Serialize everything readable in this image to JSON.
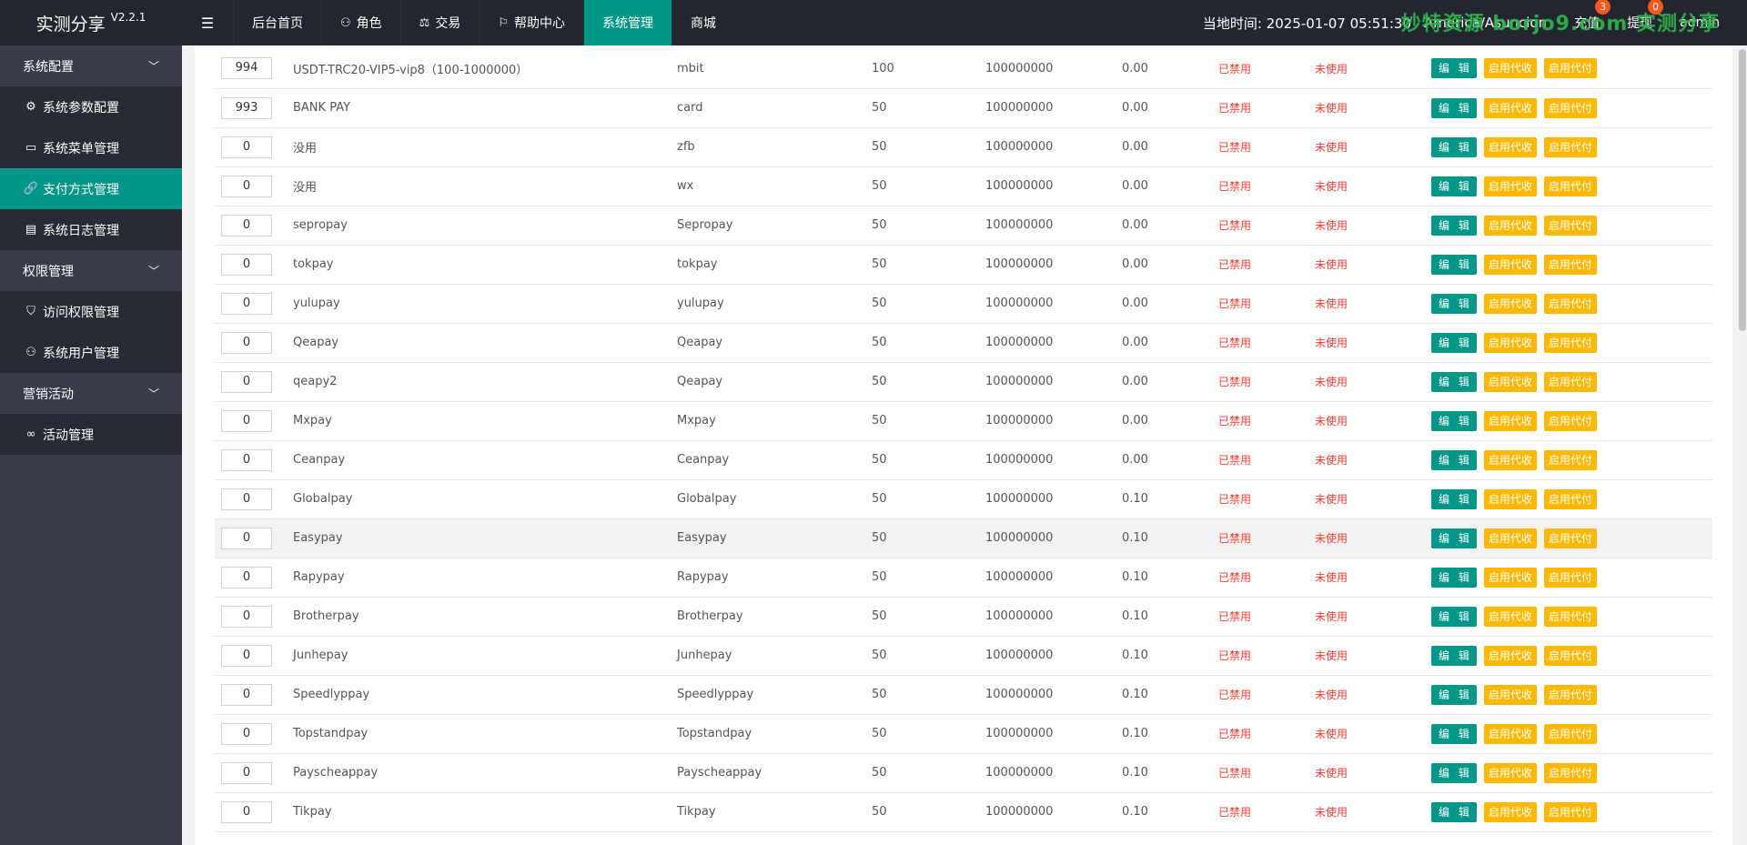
{
  "app": {
    "name": "实测分享",
    "version": "V2.2.1"
  },
  "topnav": [
    {
      "label": "后台首页",
      "icon": ""
    },
    {
      "label": "角色",
      "icon": "user-icon"
    },
    {
      "label": "交易",
      "icon": "scale-icon"
    },
    {
      "label": "帮助中心",
      "icon": "flag-icon"
    },
    {
      "label": "系统管理",
      "icon": ""
    },
    {
      "label": "商城",
      "icon": ""
    }
  ],
  "header": {
    "time_label": "当地时间: 2025-01-07 05:51:30",
    "timezone": "America/Asuncion",
    "recharge": {
      "label": "充值",
      "badge": "3"
    },
    "withdraw": {
      "label": "提现",
      "badge": "0"
    },
    "user": "admin",
    "watermark": "妙特资源 borjo9.com 实测分享"
  },
  "sidebar": {
    "groups": [
      {
        "label": "系统配置",
        "items": [
          {
            "label": "系统参数配置",
            "icon": "gear-icon"
          },
          {
            "label": "系统菜单管理",
            "icon": "window-icon"
          },
          {
            "label": "支付方式管理",
            "icon": "link-icon",
            "active": true
          },
          {
            "label": "系统日志管理",
            "icon": "doc-icon"
          }
        ]
      },
      {
        "label": "权限管理",
        "items": [
          {
            "label": "访问权限管理",
            "icon": "shield-icon"
          },
          {
            "label": "系统用户管理",
            "icon": "user-icon"
          }
        ]
      },
      {
        "label": "营销活动",
        "items": [
          {
            "label": "活动管理",
            "icon": "infinity-icon"
          }
        ]
      }
    ]
  },
  "table": {
    "actions": {
      "edit": "编 辑",
      "collect": "启用代收",
      "pay": "启用代付"
    },
    "rows": [
      {
        "sort": "994",
        "name": "USDT-TRC20-VIP5-vip8（100-1000000）",
        "code": "mbit",
        "rate": "100",
        "max": "100000000",
        "fee": "0.00",
        "status": "已禁用",
        "used": "未使用"
      },
      {
        "sort": "993",
        "name": "BANK PAY",
        "code": "card",
        "rate": "50",
        "max": "100000000",
        "fee": "0.00",
        "status": "已禁用",
        "used": "未使用"
      },
      {
        "sort": "0",
        "name": "没用",
        "code": "zfb",
        "rate": "50",
        "max": "100000000",
        "fee": "0.00",
        "status": "已禁用",
        "used": "未使用"
      },
      {
        "sort": "0",
        "name": "没用",
        "code": "wx",
        "rate": "50",
        "max": "100000000",
        "fee": "0.00",
        "status": "已禁用",
        "used": "未使用"
      },
      {
        "sort": "0",
        "name": "sepropay",
        "code": "Sepropay",
        "rate": "50",
        "max": "100000000",
        "fee": "0.00",
        "status": "已禁用",
        "used": "未使用"
      },
      {
        "sort": "0",
        "name": "tokpay",
        "code": "tokpay",
        "rate": "50",
        "max": "100000000",
        "fee": "0.00",
        "status": "已禁用",
        "used": "未使用"
      },
      {
        "sort": "0",
        "name": "yulupay",
        "code": "yulupay",
        "rate": "50",
        "max": "100000000",
        "fee": "0.00",
        "status": "已禁用",
        "used": "未使用"
      },
      {
        "sort": "0",
        "name": "Qeapay",
        "code": "Qeapay",
        "rate": "50",
        "max": "100000000",
        "fee": "0.00",
        "status": "已禁用",
        "used": "未使用"
      },
      {
        "sort": "0",
        "name": "qeapy2",
        "code": "Qeapay",
        "rate": "50",
        "max": "100000000",
        "fee": "0.00",
        "status": "已禁用",
        "used": "未使用"
      },
      {
        "sort": "0",
        "name": "Mxpay",
        "code": "Mxpay",
        "rate": "50",
        "max": "100000000",
        "fee": "0.00",
        "status": "已禁用",
        "used": "未使用"
      },
      {
        "sort": "0",
        "name": "Ceanpay",
        "code": "Ceanpay",
        "rate": "50",
        "max": "100000000",
        "fee": "0.00",
        "status": "已禁用",
        "used": "未使用"
      },
      {
        "sort": "0",
        "name": "Globalpay",
        "code": "Globalpay",
        "rate": "50",
        "max": "100000000",
        "fee": "0.10",
        "status": "已禁用",
        "used": "未使用"
      },
      {
        "sort": "0",
        "name": "Easypay",
        "code": "Easypay",
        "rate": "50",
        "max": "100000000",
        "fee": "0.10",
        "status": "已禁用",
        "used": "未使用",
        "hover": true
      },
      {
        "sort": "0",
        "name": "Rapypay",
        "code": "Rapypay",
        "rate": "50",
        "max": "100000000",
        "fee": "0.10",
        "status": "已禁用",
        "used": "未使用"
      },
      {
        "sort": "0",
        "name": "Brotherpay",
        "code": "Brotherpay",
        "rate": "50",
        "max": "100000000",
        "fee": "0.10",
        "status": "已禁用",
        "used": "未使用"
      },
      {
        "sort": "0",
        "name": "Junhepay",
        "code": "Junhepay",
        "rate": "50",
        "max": "100000000",
        "fee": "0.10",
        "status": "已禁用",
        "used": "未使用"
      },
      {
        "sort": "0",
        "name": "Speedlyppay",
        "code": "Speedlyppay",
        "rate": "50",
        "max": "100000000",
        "fee": "0.10",
        "status": "已禁用",
        "used": "未使用"
      },
      {
        "sort": "0",
        "name": "Topstandpay",
        "code": "Topstandpay",
        "rate": "50",
        "max": "100000000",
        "fee": "0.10",
        "status": "已禁用",
        "used": "未使用"
      },
      {
        "sort": "0",
        "name": "Payscheappay",
        "code": "Payscheappay",
        "rate": "50",
        "max": "100000000",
        "fee": "0.10",
        "status": "已禁用",
        "used": "未使用"
      },
      {
        "sort": "0",
        "name": "Tikpay",
        "code": "Tikpay",
        "rate": "50",
        "max": "100000000",
        "fee": "0.10",
        "status": "已禁用",
        "used": "未使用"
      }
    ]
  },
  "colors": {
    "primary": "#009688",
    "warning": "#ffb800",
    "danger": "#ff3b30",
    "header_bg": "#23262e",
    "sidebar_bg": "#393d49"
  }
}
